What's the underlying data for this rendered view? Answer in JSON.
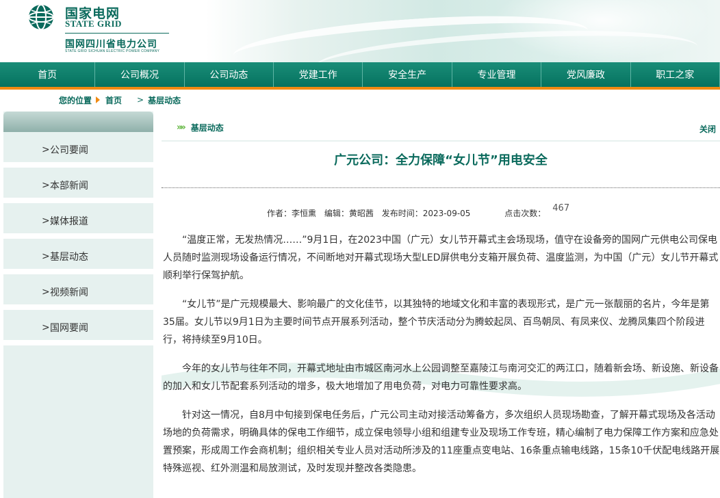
{
  "header": {
    "brand_cn": "国家电网",
    "brand_en": "STATE GRID",
    "company_cn": "国网四川省电力公司",
    "company_en": "STATE GRID SICHUAN ELECTRIC POWER COMPANY"
  },
  "nav": {
    "items": [
      "首页",
      "公司概况",
      "公司动态",
      "党建工作",
      "安全生产",
      "专业管理",
      "党风廉政",
      "职工之家"
    ]
  },
  "breadcrumb": {
    "label": "您的位置",
    "home": "首页",
    "current": "基层动态"
  },
  "sidebar": {
    "items": [
      "公司要闻",
      "本部新闻",
      "媒体报道",
      "基层动态",
      "视频新闻",
      "国网要闻"
    ]
  },
  "section": {
    "title": "基层动态",
    "close": "关闭"
  },
  "article": {
    "title": "广元公司：全力保障“女儿节”用电安全",
    "author": "作者：李恒熏",
    "editor": "编辑：黄昭茜",
    "published": "发布时间：2023-09-05",
    "views_label": "点击次数：",
    "views": "467",
    "paragraphs": [
      "“温度正常，无发热情况……”9月1日，在2023中国（广元）女儿节开幕式主会场现场，值守在设备旁的国网广元供电公司保电人员随时监测现场设备运行情况，不间断地对开幕式现场大型LED屏供电分支箱开展负荷、温度监测，为中国（广元）女儿节开幕式顺利举行保驾护航。",
      "“女儿节”是广元规模最大、影响最广的文化佳节，以其独特的地域文化和丰富的表现形式，是广元一张靓丽的名片，今年是第35届。女儿节以9月1日为主要时间节点开展系列活动，整个节庆活动分为腾蛟起凤、百鸟朝凤、有凤来仪、龙腾凤集四个阶段进行，将持续至9月10日。",
      "今年的女儿节与往年不同，开幕式地址由市城区南河水上公园调整至嘉陵江与南河交汇的两江口，随着新会场、新设施、新设备的加入和女儿节配套系列活动的增多，极大地增加了用电负荷，对电力可靠性要求高。",
      "针对这一情况，自8月中旬接到保电任务后，广元公司主动对接活动筹备方，多次组织人员现场勘查，了解开幕式现场及各活动场地的负荷需求，明确具体的保电工作细节，成立保电领导小组和组建专业及现场工作专班，精心编制了电力保障工作方案和应急处置预案，形成周工作会商机制；组织相关专业人员对活动所涉及的11座重点变电站、16条重点输电线路，15条10千伏配电线路开展特殊巡视、红外测温和局放测试，及时发现并整改各类隐患。"
    ]
  },
  "colors": {
    "brand_green": "#0a6a5c",
    "nav_green": "#0b7a66",
    "accent_orange": "#f08a12"
  }
}
